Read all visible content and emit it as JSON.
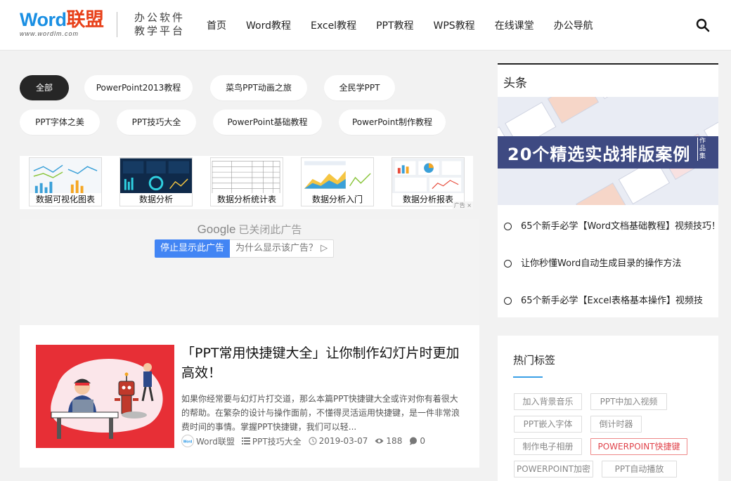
{
  "header": {
    "logo_main": "Word",
    "logo_cn": "联盟",
    "logo_sub": "www.wordlm.com",
    "slogan_line1": "办公软件",
    "slogan_line2": "教学平台",
    "nav": [
      "首页",
      "Word教程",
      "Excel教程",
      "PPT教程",
      "WPS教程",
      "在线课堂",
      "办公导航"
    ]
  },
  "categories": [
    {
      "label": "全部",
      "active": true
    },
    {
      "label": "PowerPoint2013教程"
    },
    {
      "label": "菜鸟PPT动画之旅"
    },
    {
      "label": "全民学PPT"
    },
    {
      "label": "PPT字体之美"
    },
    {
      "label": "PPT技巧大全"
    },
    {
      "label": "PowerPoint基础教程"
    },
    {
      "label": "PowerPoint制作教程"
    }
  ],
  "ad_strip": {
    "items": [
      "数据可视化图表",
      "数据分析",
      "数据分析统计表",
      "数据分析入门",
      "数据分析报表"
    ],
    "mark": "广告 ×"
  },
  "google_ad": {
    "brand": "Google",
    "closed_text": "已关闭此广告",
    "stop_label": "停止显示此广告",
    "why_label": "为什么显示该广告？ ▷"
  },
  "article": {
    "title": "「PPT常用快捷键大全」让你制作幻灯片时更加高效！",
    "excerpt": "如果你经常要与幻灯片打交道，那么本篇PPT快捷键大全或许对你有着很大的帮助。在繁杂的设计与操作面前，不懂得灵活运用快捷键，是一件非常浪费时间的事情。掌握PPT快捷键，我们可以轻...",
    "author": "Word联盟",
    "category": "PPT技巧大全",
    "date": "2019-03-07",
    "views": "188",
    "comments": "0"
  },
  "headline": {
    "title": "头条",
    "image_text": "20个精选实战排版案例",
    "image_tag": "作品集",
    "items": [
      "65个新手必学【Word文档基础教程】视频技巧！",
      "让你秒懂Word自动生成目录的操作方法",
      "65个新手必学【Excel表格基本操作】视频技"
    ]
  },
  "hot_tags": {
    "title": "热门标签",
    "tags": [
      "加入背景音乐",
      "PPT中加入视频",
      "PPT嵌入字体",
      "倒计时器",
      "制作电子相册",
      "POWERPOINT快捷键",
      "POWERPOINT加密",
      "PPT自动播放"
    ],
    "hot_index": 5
  },
  "colors": {
    "brand_blue": "#1a8fe3",
    "brand_red": "#e8411a",
    "hot_tag": "#e0434b",
    "google_blue": "#4285f4"
  }
}
